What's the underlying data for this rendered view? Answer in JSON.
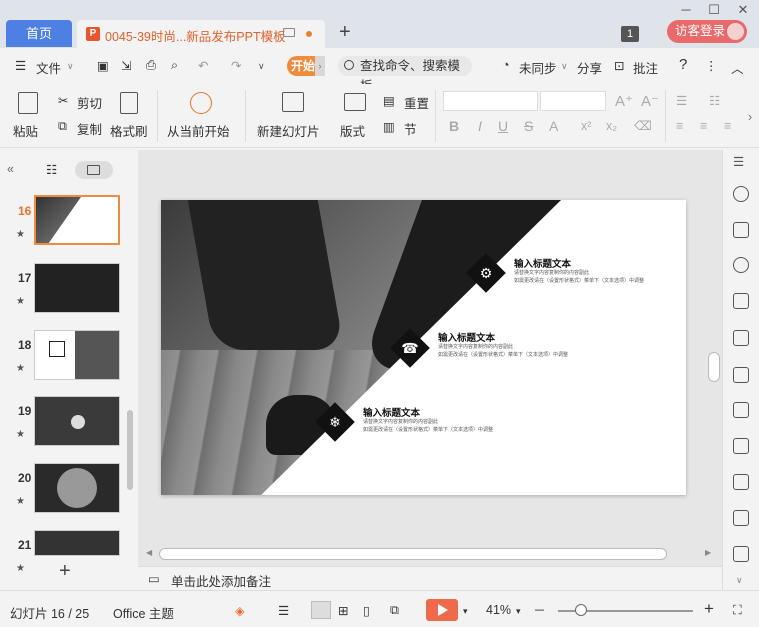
{
  "titlebar": {
    "home_tab": "首页",
    "doc_tab": "0045-39时尚...新品发布PPT模板",
    "new_tab": "+",
    "badge": "1",
    "login": "访客登录",
    "win_min": "─",
    "win_max": "☐",
    "win_close": "✕"
  },
  "menubar": {
    "file": "文件",
    "open_tab": "开始",
    "search": "查找命令、搜索模板",
    "sync": "未同步",
    "share": "分享",
    "comment": "批注",
    "help": "?"
  },
  "ribbon": {
    "paste": "粘贴",
    "cut": "剪切",
    "copy": "复制",
    "format_painter": "格式刷",
    "from_current": "从当前开始",
    "new_slide": "新建幻灯片",
    "layout": "版式",
    "reset": "重置",
    "section": "节",
    "bold": "B",
    "italic": "I",
    "underline": "U",
    "strike": "S",
    "font_color": "A"
  },
  "slides_panel": {
    "thumbnails": [
      {
        "num": "16",
        "selected": true
      },
      {
        "num": "17",
        "selected": false
      },
      {
        "num": "18",
        "selected": false
      },
      {
        "num": "19",
        "selected": false
      },
      {
        "num": "20",
        "selected": false
      },
      {
        "num": "21",
        "selected": false
      }
    ],
    "add": "+"
  },
  "slide": {
    "items": [
      {
        "title": "输入标题文本",
        "desc1": "请替换文字内容复制你的内容副此",
        "desc2": "如需更改请在（设置形状格式）菜单下（文本选项）中调整",
        "icon": "gear-icon"
      },
      {
        "title": "输入标题文本",
        "desc1": "请替换文字内容复制你的内容副此",
        "desc2": "如需更改请在（设置形状格式）菜单下（文本选项）中调整",
        "icon": "phone-icon"
      },
      {
        "title": "输入标题文本",
        "desc1": "请替换文字内容复制你的内容副此",
        "desc2": "如需更改请在（设置形状格式）菜单下（文本选项）中调整",
        "icon": "snowflake-icon"
      }
    ]
  },
  "notes": {
    "placeholder": "单击此处添加备注"
  },
  "status": {
    "slide_counter": "幻灯片 16 / 25",
    "theme": "Office 主题",
    "zoom": "41%",
    "zoom_minus": "─",
    "zoom_plus": "+"
  }
}
